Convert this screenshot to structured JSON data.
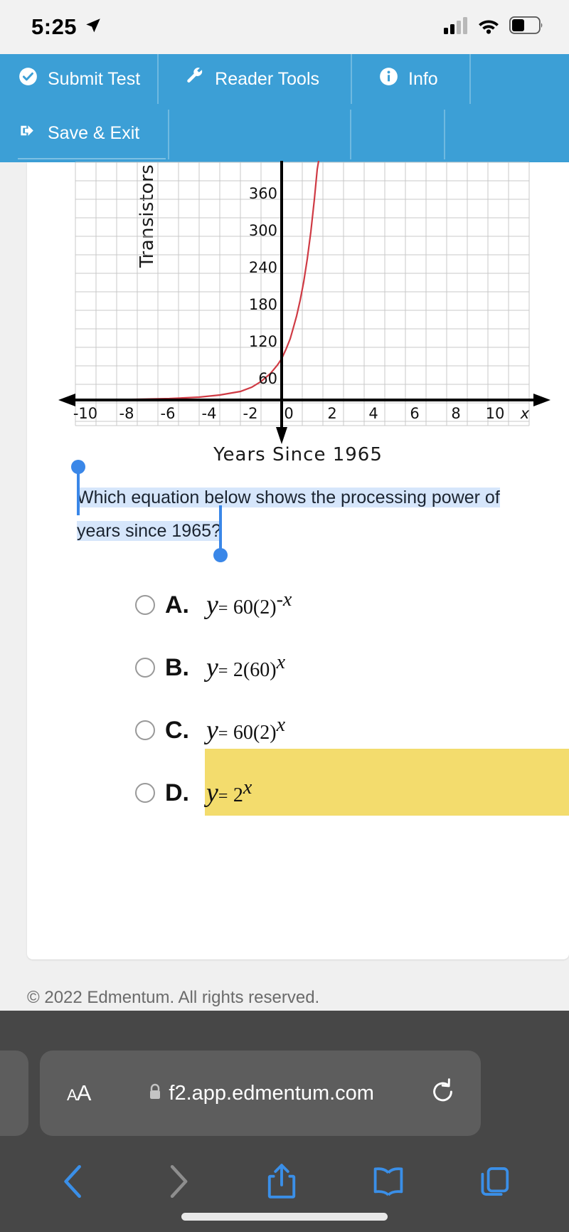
{
  "status_bar": {
    "time": "5:25",
    "location_icon": "location-arrow-icon",
    "cellular_icon": "cellular-signal-icon",
    "wifi_icon": "wifi-icon",
    "battery_icon": "battery-icon"
  },
  "toolbar": {
    "background": "#3c9fd6",
    "buttons": [
      {
        "label": "Submit Test",
        "icon": "check-circle-icon"
      },
      {
        "label": "Reader Tools",
        "icon": "wrench-icon"
      },
      {
        "label": "Info",
        "icon": "info-circle-icon"
      },
      {
        "label": "Save & Exit",
        "icon": "sign-out-icon"
      }
    ]
  },
  "chart_data": {
    "type": "line",
    "title": "",
    "xlabel": "Years Since 1965",
    "ylabel": "Transistors",
    "xlim": [
      -11,
      11
    ],
    "ylim": [
      0,
      400
    ],
    "xticks": [
      -10,
      -8,
      -6,
      -4,
      -2,
      0,
      2,
      4,
      6,
      8,
      10
    ],
    "yticks": [
      60,
      120,
      180,
      240,
      300,
      360
    ],
    "x_axis_symbol": "x",
    "grid": true,
    "series": [
      {
        "name": "y = 60(2)^x",
        "color": "#cf3a44",
        "x": [
          -10,
          -9,
          -8,
          -7,
          -6,
          -5,
          -4,
          -3,
          -2,
          -1,
          0,
          1,
          2,
          2.5,
          2.7
        ],
        "values": [
          0.06,
          0.12,
          0.23,
          0.47,
          0.94,
          1.88,
          3.75,
          7.5,
          15,
          30,
          60,
          120,
          240,
          339,
          389
        ]
      }
    ]
  },
  "question": {
    "line1": "Which equation below shows the processing power of",
    "line2": "years since 1965?",
    "selected": true,
    "selection_color": "#d6e6fb",
    "handle_color": "#3a87e8"
  },
  "choices": [
    {
      "letter": "A.",
      "equation_text": "y = 60(2)-x",
      "var": "y",
      "eq": "=",
      "coef": "60(2)",
      "exp": "-x",
      "selected": false,
      "highlighted": true,
      "highlight_color": "#f3dc6d"
    },
    {
      "letter": "B.",
      "equation_text": "y = 2(60)x",
      "var": "y",
      "eq": "=",
      "coef": "2(60)",
      "exp": "x",
      "selected": false,
      "highlighted": false
    },
    {
      "letter": "C.",
      "equation_text": "y = 60(2)x",
      "var": "y",
      "eq": "=",
      "coef": "60(2)",
      "exp": "x",
      "selected": false,
      "highlighted": false
    },
    {
      "letter": "D.",
      "equation_text": "y = 2x",
      "var": "y",
      "eq": "=",
      "coef": "2",
      "exp": "x",
      "selected": false,
      "highlighted": false
    }
  ],
  "footer": {
    "copyright": "© 2022 Edmentum. All rights reserved."
  },
  "browser": {
    "text_size_small": "A",
    "text_size_large": "A",
    "lock_icon": "lock-icon",
    "url": "f2.app.edmentum.com",
    "reload_icon": "reload-icon",
    "back_icon": "chevron-left-icon",
    "forward_icon": "chevron-right-icon",
    "share_icon": "share-icon",
    "bookmarks_icon": "book-icon",
    "tabs_icon": "tabs-icon"
  }
}
